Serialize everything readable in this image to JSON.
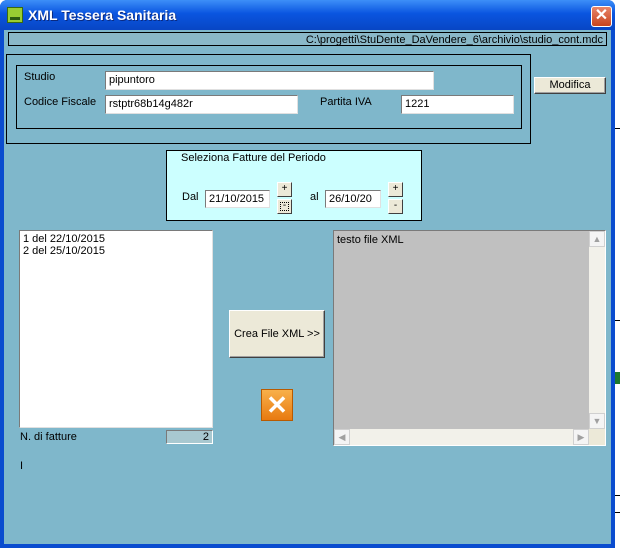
{
  "window": {
    "title": "XML  Tessera Sanitaria",
    "close_label": "✕",
    "app_icon": "app-icon"
  },
  "path": "C:\\progetti\\StuDente_DaVendere_6\\archivio\\studio_cont.mdc",
  "studio": {
    "studio_label": "Studio",
    "studio_value": "pipuntoro",
    "cf_label": "Codice Fiscale",
    "cf_value": "rstptr68b14g482r",
    "piva_label": "Partita IVA",
    "piva_value": "1221",
    "modifica_label": "Modifica"
  },
  "period": {
    "title": "Seleziona Fatture del Periodo",
    "dal_label": "Dal",
    "dal_value": "21/10/2015",
    "al_label": "al",
    "al_value": "26/10/20",
    "plus": "+",
    "minus": "-"
  },
  "invoices": {
    "items": [
      "1 del 22/10/2015",
      "2 del 25/10/2015"
    ],
    "count_label": "N. di fatture",
    "count_value": "2",
    "status_text": "I"
  },
  "actions": {
    "create_xml_label": "Crea File XML >>",
    "cancel_icon": "orange-x-icon"
  },
  "xml_preview": {
    "text": "testo file  XML"
  },
  "colors": {
    "window_bg": "#7fb7cb",
    "period_bg": "#ccffff",
    "titlebar": "#0a55e0",
    "cancel": "#f0962a"
  }
}
